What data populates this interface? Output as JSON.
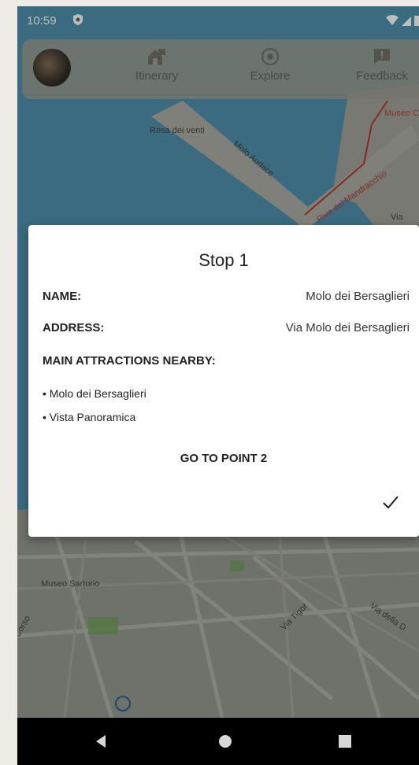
{
  "status_bar": {
    "time": "10:59"
  },
  "top_nav": {
    "items": [
      {
        "label": "Itinerary",
        "icon": "home-icon"
      },
      {
        "label": "Explore",
        "icon": "location-icon"
      },
      {
        "label": "Feedback",
        "icon": "feedback-icon"
      }
    ]
  },
  "map": {
    "labels": {
      "rosa_dei_venti": "Rosa dei venti",
      "molo_audace": "Molo Audace",
      "riva_trieste": "Riva del Mandracchio",
      "via_top": "Via",
      "museo_top": "Museo Carto",
      "museo_sartorio": "Museo Sartorio",
      "via_tigor": "Via Tigor",
      "via_della": "Via della D",
      "left_edge": "Corso"
    }
  },
  "dialog": {
    "title": "Stop 1",
    "name_label": "NAME:",
    "name_value": "Molo dei Bersaglieri",
    "address_label": "ADDRESS:",
    "address_value": "Via Molo dei Bersaglieri",
    "attractions_label": "MAIN ATTRACTIONS NEARBY:",
    "attractions": [
      "Molo dei Bersaglieri",
      "Vista Panoramica"
    ],
    "goto_label": "GO TO POINT 2"
  },
  "colors": {
    "water": "#4b8aa5",
    "land": "#8f918a",
    "dialog": "#ffffff"
  }
}
